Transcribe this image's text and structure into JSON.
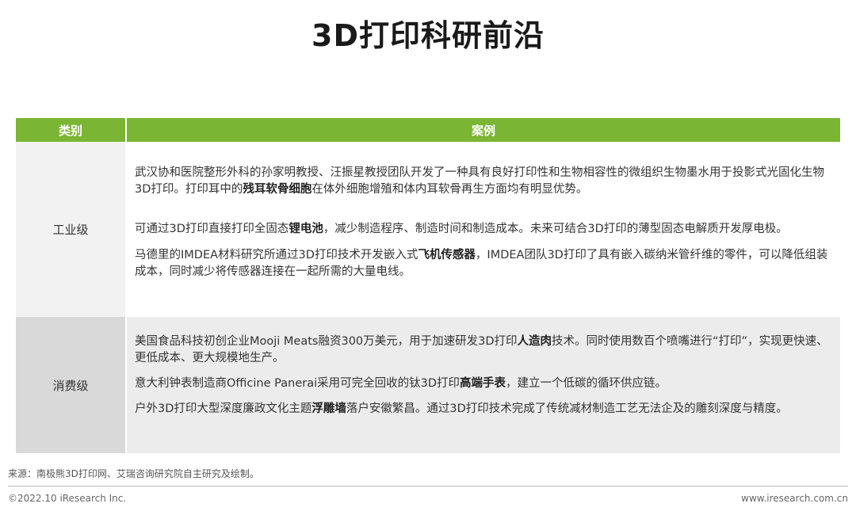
{
  "title": "3D打印科研前沿",
  "table": {
    "headers": {
      "category": "类别",
      "case": "案例"
    },
    "rows": [
      {
        "category": "工业级",
        "items": [
          {
            "pre": "武汉协和医院整形外科的孙家明教授、汪振星教授团队开发了一种具有良好打印性和生物相容性的微组织生物墨水用于投影式光固化生物3D打印。打印耳中的",
            "bold": "残耳软骨细胞",
            "post": "在体外细胞增殖和体内耳软骨再生方面均有明显优势。"
          },
          {
            "pre": "可通过3D打印直接打印全固态",
            "bold": "锂电池",
            "post": "，减少制造程序、制造时间和制造成本。未来可结合3D打印的薄型固态电解质开发厚电极。"
          },
          {
            "pre": "马德里的IMDEA材料研究所通过3D打印技术开发嵌入式",
            "bold": "飞机传感器",
            "post": "，IMDEA团队3D打印了具有嵌入碳纳米管纤维的零件，可以降低组装成本，同时减少将传感器连接在一起所需的大量电线。"
          }
        ]
      },
      {
        "category": "消费级",
        "items": [
          {
            "pre": "美国食品科技初创企业Mooji Meats融资300万美元，用于加速研发3D打印",
            "bold": "人造肉",
            "post": "技术。同时使用数百个喷嘴进行“打印”，实现更快速、更低成本、更大规模地生产。"
          },
          {
            "pre": "意大利钟表制造商Officine Panerai采用可完全回收的钛3D打印",
            "bold": "高端手表",
            "post": "，建立一个低碳的循环供应链。"
          },
          {
            "pre": "户外3D打印大型深度廉政文化主题",
            "bold": "浮雕墙",
            "post": "落户安徽繁昌。通过3D打印技术完成了传统减材制造工艺无法企及的雕刻深度与精度。"
          }
        ]
      }
    ]
  },
  "source": "来源：南极熊3D打印网、艾瑞咨询研究院自主研究及绘制。",
  "footer": {
    "copyright": "©2022.10 iResearch Inc.",
    "website": "www.iresearch.com.cn"
  },
  "colors": {
    "header_green": "#7ab534"
  }
}
